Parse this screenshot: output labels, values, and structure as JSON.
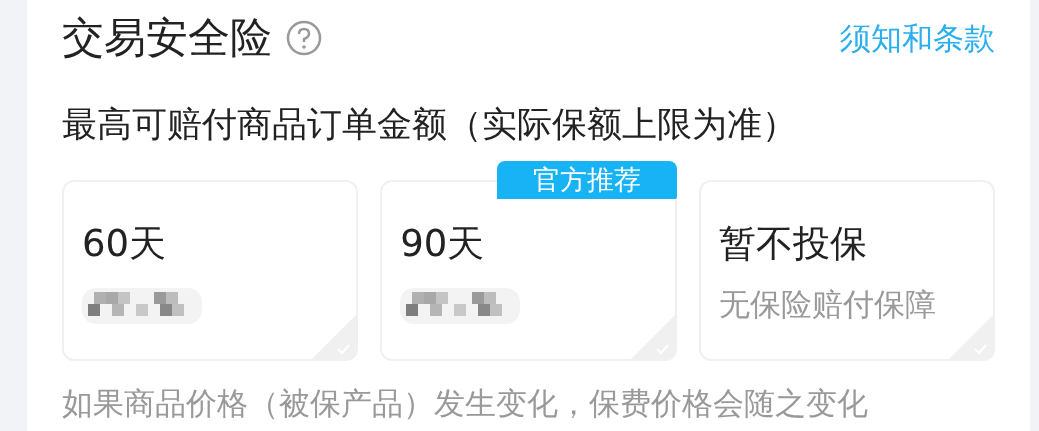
{
  "header": {
    "title": "交易安全险",
    "terms_link": "须知和条款"
  },
  "subtitle": "最高可赔付商品订单金额（实际保额上限为准）",
  "options": [
    {
      "label": "60天",
      "redacted_price": true,
      "selected": false
    },
    {
      "label": "90天",
      "redacted_price": true,
      "badge": "官方推荐",
      "selected": false
    },
    {
      "label": "暂不投保",
      "note": "无保险赔付保障",
      "selected": false
    }
  ],
  "footnote": "如果商品价格（被保产品）发生变化，保费价格会随之变化"
}
